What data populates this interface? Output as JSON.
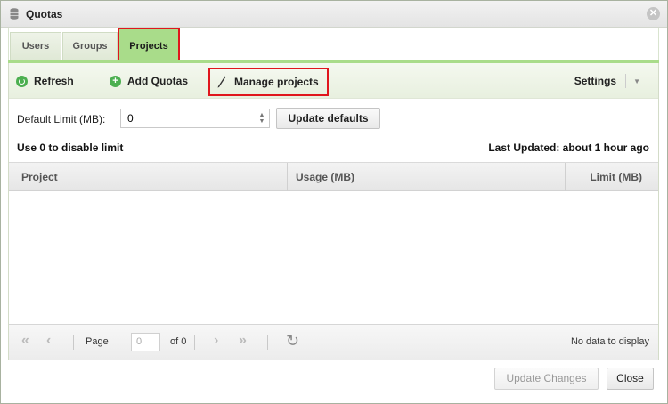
{
  "window": {
    "title": "Quotas",
    "icons": {
      "title": "database-icon",
      "close": "close-icon"
    }
  },
  "tabs": [
    {
      "label": "Users"
    },
    {
      "label": "Groups"
    },
    {
      "label": "Projects",
      "active": true
    }
  ],
  "toolbar": {
    "refresh_label": "Refresh",
    "add_quotas_label": "Add Quotas",
    "manage_projects_label": "Manage projects",
    "settings_label": "Settings"
  },
  "defaults": {
    "limit_label": "Default Limit (MB):",
    "limit_value": "0",
    "update_defaults_label": "Update defaults",
    "hint": "Use 0 to disable limit",
    "last_updated": "Last Updated: about 1 hour ago"
  },
  "grid": {
    "columns": [
      "Project",
      "Usage (MB)",
      "Limit (MB)"
    ],
    "rows": []
  },
  "pager": {
    "page_label": "Page",
    "page_value": "0",
    "of_label": "of 0",
    "status": "No data to display"
  },
  "footer": {
    "update_changes_label": "Update Changes",
    "close_label": "Close"
  },
  "colors": {
    "accent_green": "#a9dc8a",
    "highlight_red": "#e0161d",
    "add_icon_green": "#4caf50"
  }
}
